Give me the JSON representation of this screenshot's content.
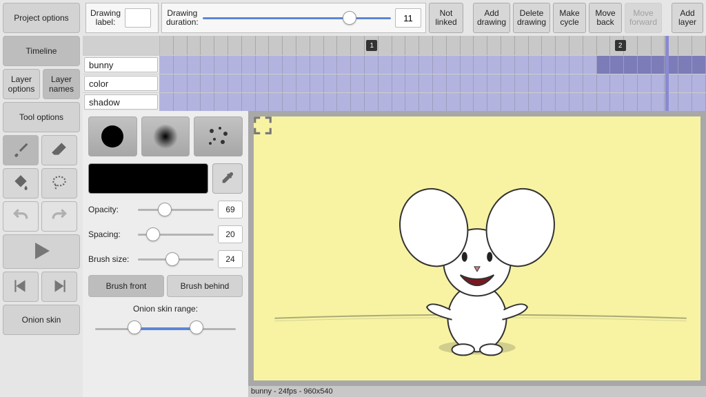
{
  "sidebar": {
    "project_options": "Project options",
    "timeline": "Timeline",
    "layer_options": "Layer\noptions",
    "layer_names": "Layer\nnames",
    "tool_options": "Tool options",
    "onion_skin": "Onion skin"
  },
  "toolbar": {
    "drawing_label": "Drawing\nlabel:",
    "drawing_label_value": "",
    "drawing_duration": "Drawing\nduration:",
    "drawing_duration_value": "11",
    "not_linked": "Not\nlinked",
    "add_drawing": "Add\ndrawing",
    "delete_drawing": "Delete\ndrawing",
    "make_cycle": "Make\ncycle",
    "move_back": "Move\nback",
    "move_forward": "Move\nforward",
    "add_layer": "Add\nlayer"
  },
  "timeline": {
    "keyframes": [
      "1",
      "2"
    ],
    "layers": [
      "bunny",
      "color",
      "shadow"
    ]
  },
  "toolpanel": {
    "opacity_label": "Opacity:",
    "opacity_value": "69",
    "spacing_label": "Spacing:",
    "spacing_value": "20",
    "brush_size_label": "Brush size:",
    "brush_size_value": "24",
    "brush_front": "Brush front",
    "brush_behind": "Brush behind",
    "onion_range": "Onion skin range:"
  },
  "status": "bunny - 24fps - 960x540",
  "icons": {
    "brush": "brush-icon",
    "eraser": "eraser-icon",
    "fill": "fill-icon",
    "lasso": "lasso-icon",
    "undo": "undo-icon",
    "redo": "redo-icon",
    "play": "play-icon",
    "step_back": "step-back-icon",
    "step_forward": "step-forward-icon",
    "eyedropper": "eyedropper-icon",
    "expand": "expand-icon"
  }
}
